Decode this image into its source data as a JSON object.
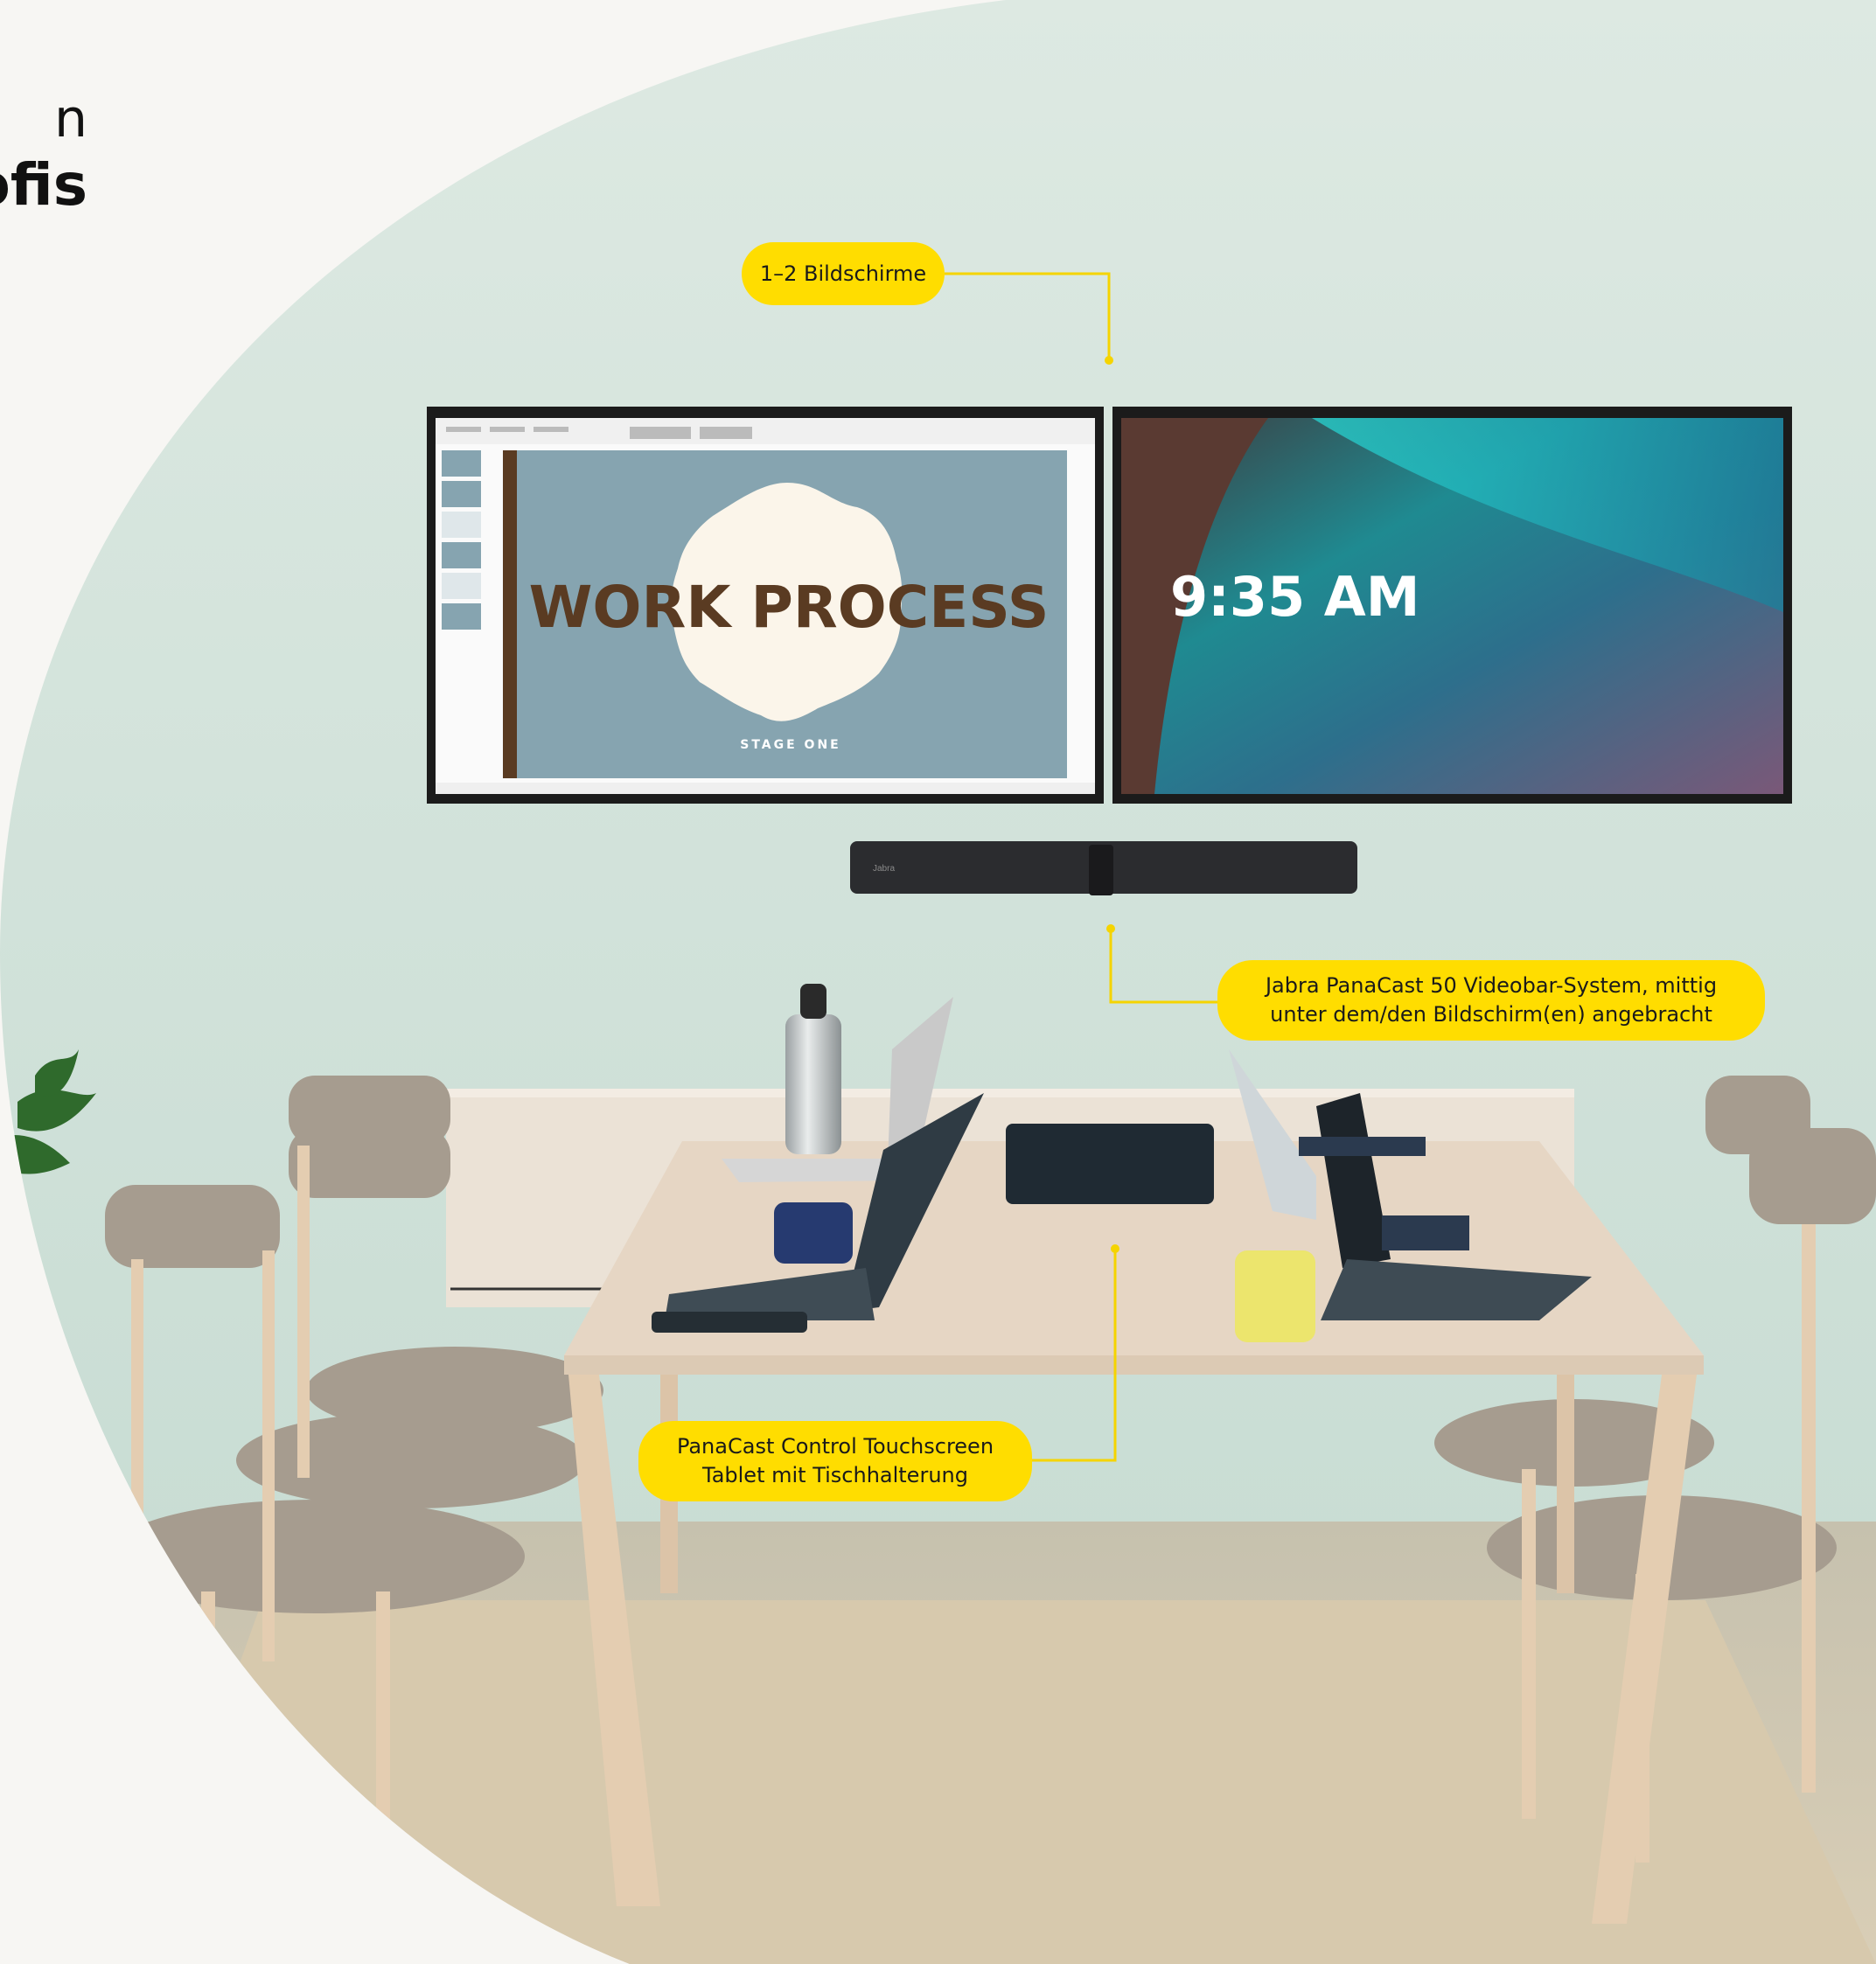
{
  "headline": {
    "line1": "n",
    "line2": "ofis"
  },
  "left_screen": {
    "slide_title": "WORK PROCESS",
    "slide_subtitle": "STAGE ONE"
  },
  "right_screen": {
    "clock": "9:35 AM"
  },
  "videobar": {
    "brand": "Jabra"
  },
  "callouts": {
    "screens": [
      "1–2 Bildschirme"
    ],
    "videobar": [
      "Jabra PanaCast 50 Videobar-System, mittig",
      "unter dem/den Bildschirm(en) angebracht"
    ],
    "tablet": [
      "PanaCast Control Touchscreen",
      "Tablet mit Tischhalterung"
    ]
  },
  "colors": {
    "accent": "#ffdd00",
    "wall": "#d6e6de",
    "table": "#e6d6c4",
    "chair_fabric": "#a69c8f",
    "slide_bg": "#86a4b0",
    "slide_title": "#5a3b22"
  }
}
